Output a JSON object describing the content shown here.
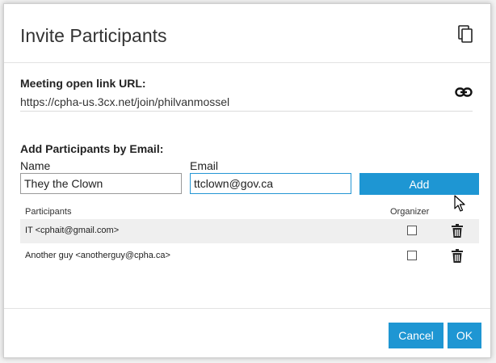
{
  "dialog": {
    "title": "Invite Participants"
  },
  "meeting_link": {
    "label": "Meeting open link URL:",
    "url": "https://cpha-us.3cx.net/join/philvanmossel"
  },
  "add_participants": {
    "label": "Add Participants by Email:",
    "name_label": "Name",
    "name_value": "They the Clown",
    "email_label": "Email",
    "email_value": "ttclown@gov.ca",
    "add_label": "Add"
  },
  "participants": {
    "col_participants": "Participants",
    "col_organizer": "Organizer",
    "rows": [
      {
        "name": "IT <cphait@gmail.com>",
        "organizer": false
      },
      {
        "name": "Another guy <anotherguy@cpha.ca>",
        "organizer": false
      }
    ]
  },
  "footer": {
    "cancel_label": "Cancel",
    "ok_label": "OK"
  },
  "colors": {
    "accent": "#1e96d3",
    "row_alt": "#efefef"
  }
}
